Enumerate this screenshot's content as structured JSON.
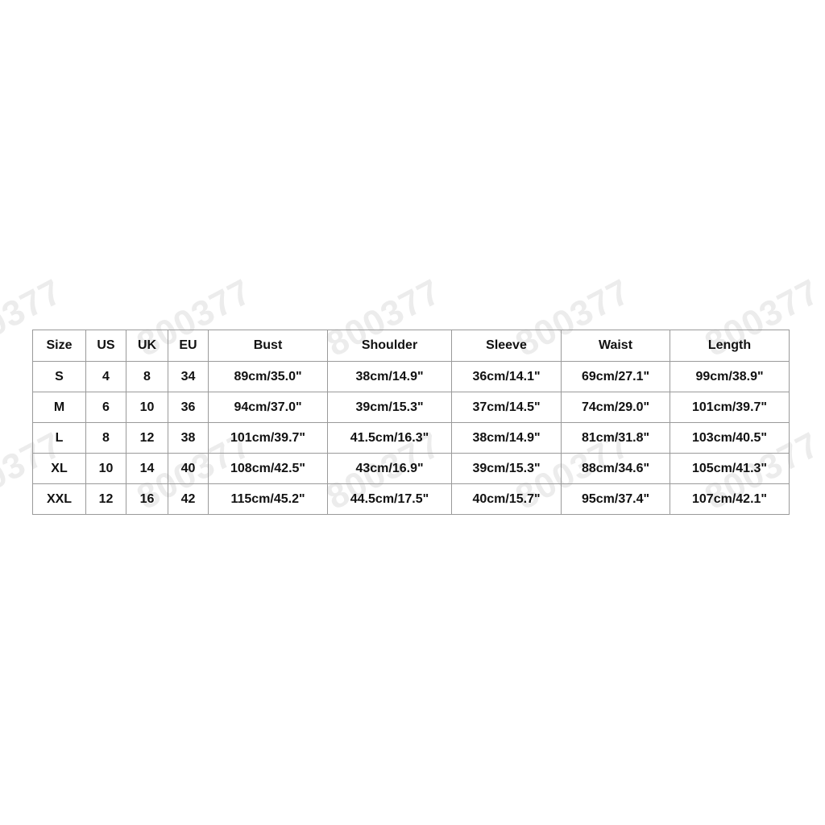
{
  "watermark_text": "800377",
  "size_chart": {
    "headers": [
      "Size",
      "US",
      "UK",
      "EU",
      "Bust",
      "Shoulder",
      "Sleeve",
      "Waist",
      "Length"
    ],
    "rows": [
      [
        "S",
        "4",
        "8",
        "34",
        "89cm/35.0\"",
        "38cm/14.9\"",
        "36cm/14.1\"",
        "69cm/27.1\"",
        "99cm/38.9\""
      ],
      [
        "M",
        "6",
        "10",
        "36",
        "94cm/37.0\"",
        "39cm/15.3\"",
        "37cm/14.5\"",
        "74cm/29.0\"",
        "101cm/39.7\""
      ],
      [
        "L",
        "8",
        "12",
        "38",
        "101cm/39.7\"",
        "41.5cm/16.3\"",
        "38cm/14.9\"",
        "81cm/31.8\"",
        "103cm/40.5\""
      ],
      [
        "XL",
        "10",
        "14",
        "40",
        "108cm/42.5\"",
        "43cm/16.9\"",
        "39cm/15.3\"",
        "88cm/34.6\"",
        "105cm/41.3\""
      ],
      [
        "XXL",
        "12",
        "16",
        "42",
        "115cm/45.2\"",
        "44.5cm/17.5\"",
        "40cm/15.7\"",
        "95cm/37.4\"",
        "107cm/42.1\""
      ]
    ]
  }
}
